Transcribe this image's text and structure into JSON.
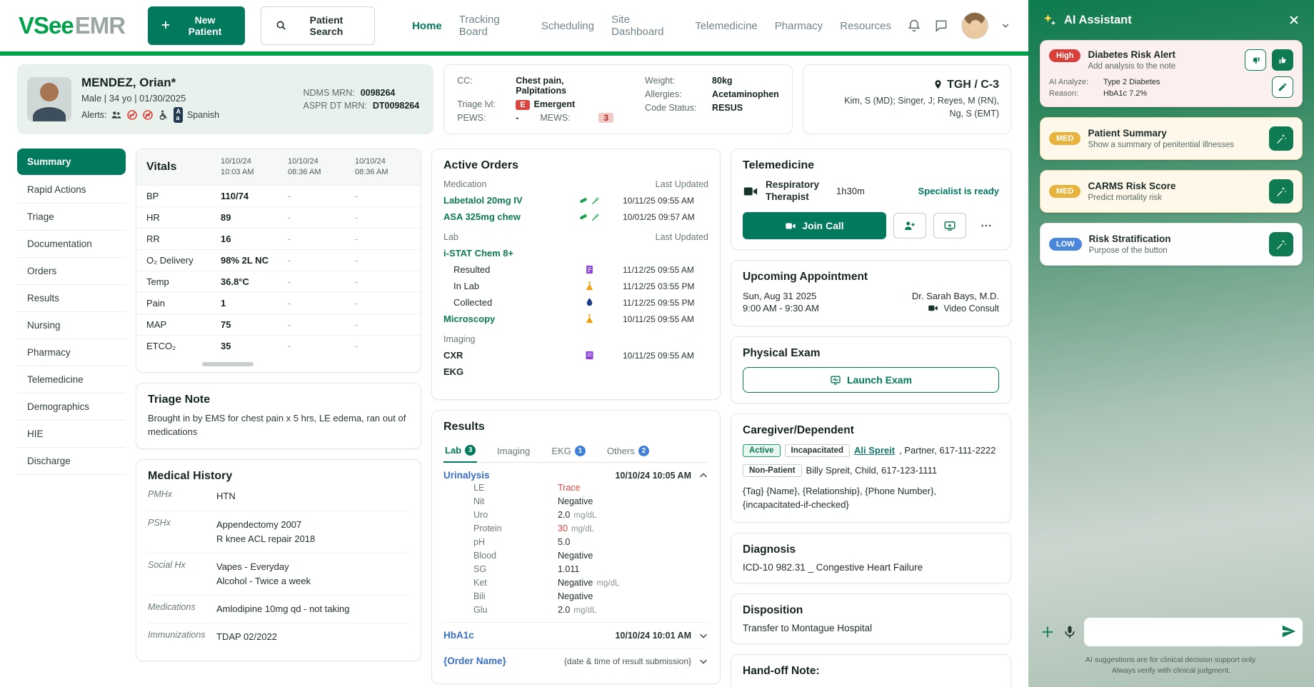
{
  "navbar": {
    "logo_primary": "VSee",
    "logo_secondary": "EMR",
    "new_patient": "New Patient",
    "patient_search": "Patient Search",
    "links": [
      "Home",
      "Tracking Board",
      "Scheduling",
      "Site Dashboard",
      "Telemedicine",
      "Pharmacy",
      "Resources"
    ]
  },
  "patient": {
    "name": "MENDEZ, Orian*",
    "demographics": "Male   |   34 yo   |   01/30/2025",
    "alerts_label": "Alerts:",
    "language": "Spanish",
    "mrn1_label": "NDMS MRN:",
    "mrn1_value": "0098264",
    "mrn2_label": "ASPR DT MRN:",
    "mrn2_value": "DT0098264"
  },
  "chief": {
    "cc_label": "CC:",
    "cc_value": "Chest pain, Palpitations",
    "triage_label": "Triage lvl:",
    "triage_code": "E",
    "triage_value": "Emergent",
    "pews_label": "PEWS:",
    "pews_value": "-",
    "mews_label": "MEWS:",
    "mews_value": "3",
    "weight_label": "Weight:",
    "weight_value": "80kg",
    "allergies_label": "Allergies:",
    "allergies_value": "Acetaminophen",
    "code_label": "Code Status:",
    "code_value": "RESUS"
  },
  "location": {
    "name": "TGH / C-3",
    "team": "Kim, S (MD); Singer, J; Reyes, M (RN),\nNg, S (EMT)"
  },
  "sidebar": [
    "Summary",
    "Rapid Actions",
    "Triage",
    "Documentation",
    "Orders",
    "Results",
    "Nursing",
    "Pharmacy",
    "Telemedicine",
    "Demographics",
    "HIE",
    "Discharge"
  ],
  "vitals": {
    "title": "Vitals",
    "col1": "10/10/24\n10:03 AM",
    "col2": "10/10/24\n08:36 AM",
    "col3": "10/10/24\n08:36 AM",
    "rows": [
      {
        "label": "BP",
        "v1": "110/74",
        "v2": "-",
        "v3": "-"
      },
      {
        "label": "HR",
        "v1": "89",
        "v2": "-",
        "v3": "-"
      },
      {
        "label": "RR",
        "v1": "16",
        "v2": "-",
        "v3": "-"
      },
      {
        "label": "O₂ Delivery",
        "v1": "98% 2L NC",
        "v2": "-",
        "v3": "-"
      },
      {
        "label": "Temp",
        "v1": "36.8°C",
        "v2": "-",
        "v3": "-"
      },
      {
        "label": "Pain",
        "v1": "1",
        "v2": "-",
        "v3": "-"
      },
      {
        "label": "MAP",
        "v1": "75",
        "v2": "-",
        "v3": "-"
      },
      {
        "label": "ETCO₂",
        "v1": "35",
        "v2": "-",
        "v3": "-"
      }
    ]
  },
  "triage_note": {
    "title": "Triage Note",
    "text": "Brought in by EMS for chest pain x 5 hrs, LE edema, ran out of medications"
  },
  "history": {
    "title": "Medical History",
    "rows": [
      {
        "label": "PMHx",
        "text": "HTN"
      },
      {
        "label": "PSHx",
        "text": "Appendectomy 2007\nR knee ACL repair 2018"
      },
      {
        "label": "Social Hx",
        "text": "Vapes - Everyday\nAlcohol - Twice a week"
      },
      {
        "label": "Medications",
        "text": "Amlodipine 10mg qd - not taking"
      },
      {
        "label": "Immunizations",
        "text": "TDAP 02/2022"
      }
    ]
  },
  "orders": {
    "title": "Active Orders",
    "medication_header": "Medication",
    "lab_header": "Lab",
    "imaging_header": "Imaging",
    "last_updated": "Last Updated",
    "med1_name": "Labetalol 20mg IV",
    "med1_time": "10/11/25  09:55 AM",
    "med2_name": "ASA 325mg chew",
    "med2_time": "10/01/25  09:57 AM",
    "lab_parent": "i-STAT Chem 8+",
    "lab_child1_name": "Resulted",
    "lab_child1_time": "11/12/25  09:55 AM",
    "lab_child2_name": "In Lab",
    "lab_child2_time": "11/12/25  03:55 PM",
    "lab_child3_name": "Collected",
    "lab_child3_time": "11/12/25  09:55 PM",
    "lab2_name": "Microscopy",
    "lab2_time": "10/11/25  09:55 AM",
    "img1_name": "CXR",
    "img1_time": "10/11/25  09:55 AM",
    "clipped_name": "EKG"
  },
  "results": {
    "title": "Results",
    "tab1": "Lab",
    "tab1_badge": "3",
    "tab2": "Imaging",
    "tab3": "EKG",
    "tab3_badge": "1",
    "tab4": "Others",
    "tab4_badge": "2",
    "panel1_name": "Urinalysis",
    "panel1_time": "10/10/24 10:05 AM",
    "panel1_rows": [
      {
        "label": "LE",
        "value": "Trace",
        "unit": ""
      },
      {
        "label": "Nit",
        "value": "Negative",
        "unit": ""
      },
      {
        "label": "Uro",
        "value": "2.0",
        "unit": "mg/dL"
      },
      {
        "label": "Protein",
        "value": "30",
        "unit": "mg/dL"
      },
      {
        "label": "pH",
        "value": "5.0",
        "unit": ""
      },
      {
        "label": "Blood",
        "value": "Negative",
        "unit": ""
      },
      {
        "label": "SG",
        "value": "1.011",
        "unit": ""
      },
      {
        "label": "Ket",
        "value": "Negative",
        "unit": "mg/dL"
      },
      {
        "label": "Bili",
        "value": "Negative",
        "unit": ""
      },
      {
        "label": "Glu",
        "value": "2.0",
        "unit": "mg/dL"
      }
    ],
    "panel2_name": "HbA1c",
    "panel2_time": "10/10/24 10:01 AM",
    "panel3_name": "{Order Name}",
    "panel3_time": "{date & time of result submission}"
  },
  "telemedicine": {
    "title": "Telemedicine",
    "specialty": "Respiratory\nTherapist",
    "duration": "1h30m",
    "status": "Specialist is ready",
    "join_call": "Join Call"
  },
  "appointment": {
    "title": "Upcoming Appointment",
    "date": "Sun, Aug 31 2025",
    "time": "9:00 AM - 9:30 AM",
    "doctor": "Dr. Sarah Bays, M.D.",
    "type": "Video Consult"
  },
  "physical_exam": {
    "title": "Physical Exam",
    "launch": "Launch Exam"
  },
  "caregiver": {
    "title": "Caregiver/Dependent",
    "badge_active": "Active",
    "badge_incapacitated": "Incapacitated",
    "contact1_name": "Ali Spreit",
    "contact1_rest": ", Partner, 617-111-2222",
    "badge_nonpatient": "Non-Patient",
    "contact2": "Billy Spreit, Child, 617-123-1111",
    "template_row": "{Tag}  {Name}, {Relationship}, {Phone Number}, {incapacitated-if-checked}"
  },
  "diagnosis": {
    "title": "Diagnosis",
    "text": "ICD-10 982.31 _ Congestive Heart Failure"
  },
  "disposition": {
    "title": "Disposition",
    "text": "Transfer to Montague Hospital"
  },
  "handoff": {
    "title": "Hand-off Note:"
  },
  "ai": {
    "title": "AI Assistant",
    "card1_severity": "High",
    "card1_title": "Diabetes Risk Alert",
    "card1_subtitle": "Add analysis to the note",
    "card1_row1_label": "AI Analyze:",
    "card1_row1_value": "Type 2 Diabetes",
    "card1_row2_label": "Reason:",
    "card1_row2_value": "HbA1c 7.2%",
    "card2_severity": "MED",
    "card2_title": "Patient Summary",
    "card2_subtitle": "Show a summary of penitential illnesses",
    "card3_severity": "MED",
    "card3_title": "CARMS Risk Score",
    "card3_subtitle": "Predict mortality risk",
    "card4_severity": "LOW",
    "card4_title": "Risk Stratification",
    "card4_subtitle": "Purpose of the button",
    "disclaimer": "AI suggestions are for clinical decision support only.\nAlways verify with clinical judgment."
  }
}
